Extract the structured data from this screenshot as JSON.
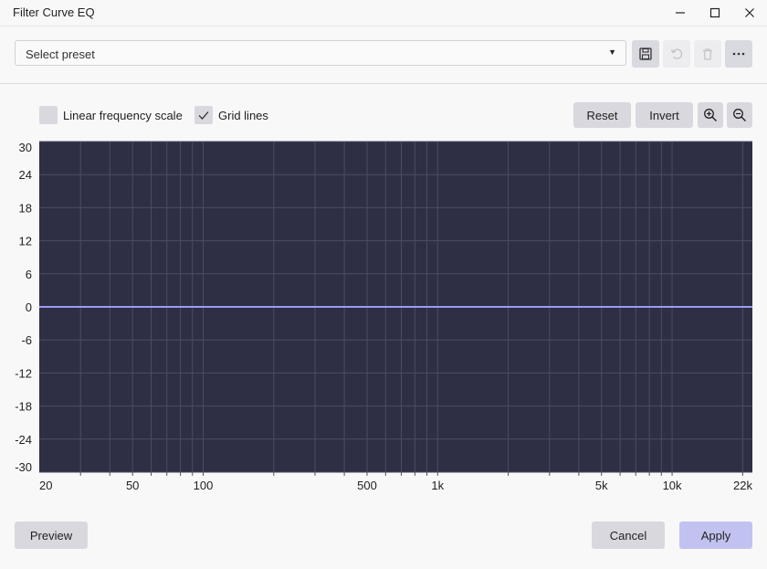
{
  "window": {
    "title": "Filter Curve EQ"
  },
  "toolbar": {
    "preset_placeholder": "Select preset",
    "icons": [
      "save-icon",
      "undo-icon",
      "trash-icon",
      "more-icon"
    ]
  },
  "options": {
    "linear_label": "Linear frequency scale",
    "linear_checked": false,
    "grid_label": "Grid lines",
    "grid_checked": true,
    "reset_label": "Reset",
    "invert_label": "Invert"
  },
  "colors": {
    "plot_bg": "#2e2e44",
    "grid": "#4c4c64",
    "curve": "#9c9cf0",
    "apply_bg": "#c2c2f0"
  },
  "chart_data": {
    "type": "line",
    "title": "",
    "xlabel": "",
    "ylabel": "",
    "x_scale": "log",
    "xlim": [
      20,
      22000
    ],
    "ylim": [
      -30,
      30
    ],
    "grid": true,
    "y_ticks": [
      "30",
      "24",
      "18",
      "12",
      "6",
      "0",
      "-6",
      "-12",
      "-18",
      "-24",
      "-30"
    ],
    "x_ticks": [
      {
        "value": 20,
        "label": "20"
      },
      {
        "value": 50,
        "label": "50"
      },
      {
        "value": 100,
        "label": "100"
      },
      {
        "value": 500,
        "label": "500"
      },
      {
        "value": 1000,
        "label": "1k"
      },
      {
        "value": 5000,
        "label": "5k"
      },
      {
        "value": 10000,
        "label": "10k"
      },
      {
        "value": 22000,
        "label": "22k"
      }
    ],
    "series": [
      {
        "x": [
          20,
          22000
        ],
        "y": [
          0,
          0
        ]
      }
    ]
  },
  "footer": {
    "preview_label": "Preview",
    "cancel_label": "Cancel",
    "apply_label": "Apply"
  }
}
